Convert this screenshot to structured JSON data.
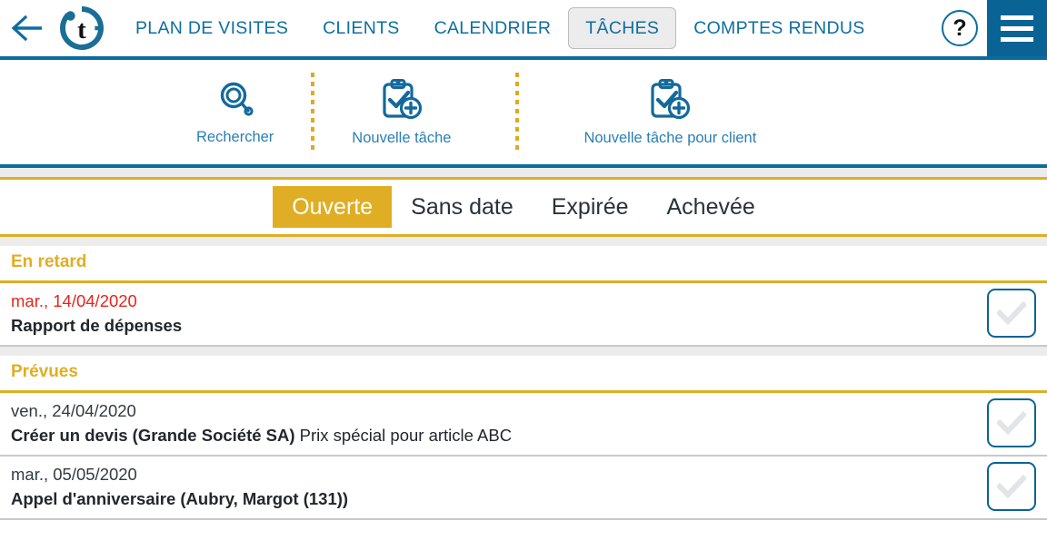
{
  "topbar": {
    "back_icon": "arrow-left-icon",
    "logo": "tolina-t-logo",
    "nav": [
      {
        "label": "PLAN DE VISITES",
        "active": false
      },
      {
        "label": "CLIENTS",
        "active": false
      },
      {
        "label": "CALENDRIER",
        "active": false
      },
      {
        "label": "TÂCHES",
        "active": true
      },
      {
        "label": "COMPTES RENDUS",
        "active": false
      }
    ],
    "help_label": "?",
    "menu_icon": "hamburger-menu-icon"
  },
  "toolbar": {
    "items": [
      {
        "label": "Rechercher",
        "icon": "search-icon"
      },
      {
        "label": "Nouvelle tâche",
        "icon": "clipboard-check-plus-icon"
      },
      {
        "label": "Nouvelle tâche pour client",
        "icon": "clipboard-check-plus-icon"
      }
    ]
  },
  "tabs": [
    {
      "label": "Ouverte",
      "active": true
    },
    {
      "label": "Sans date",
      "active": false
    },
    {
      "label": "Expirée",
      "active": false
    },
    {
      "label": "Achevée",
      "active": false
    }
  ],
  "groups": [
    {
      "title": "En retard",
      "rows": [
        {
          "date": "mar., 14/04/2020",
          "overdue": true,
          "title_bold": "Rapport de dépenses",
          "title_rest": "",
          "checkbox_icon": "checkmark-icon"
        }
      ]
    },
    {
      "title": "Prévues",
      "rows": [
        {
          "date": "ven., 24/04/2020",
          "overdue": false,
          "title_bold": "Créer un devis (Grande Société SA)",
          "title_rest": " Prix spécial pour article ABC",
          "checkbox_icon": "checkmark-icon"
        },
        {
          "date": "mar., 05/05/2020",
          "overdue": false,
          "title_bold": "Appel d'anniversaire (Aubry, Margot (131))",
          "title_rest": "",
          "checkbox_icon": "checkmark-icon"
        }
      ]
    }
  ],
  "colors": {
    "brand_blue": "#0a6395",
    "link_blue": "#0d6ea0",
    "accent_gold": "#e0ae24",
    "overdue_red": "#e8241c",
    "gray_band": "#ececec"
  }
}
